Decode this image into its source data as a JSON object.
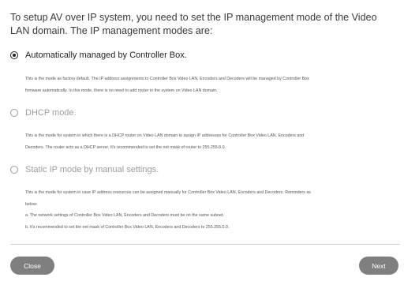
{
  "intro": "To setup AV over IP system, you need to set the IP management mode of the Video LAN domain. The IP management modes are:",
  "options": [
    {
      "label": "Automatically managed by Controller Box.",
      "selected": true,
      "description": [
        "This is the mode as factory default. The IP address assignments to Controller Box Video LAN, Encoders and Decoders will be managed by Controller Box",
        "firmware automatically. In this mode, there is no need to add router in the system on Video LAN domain."
      ]
    },
    {
      "label": "DHCP mode.",
      "selected": false,
      "description": [
        "This is the mode for system in which there is a DHCP router on Video LAN domain to assign IP addresses for Controller Box Video LAN, Encoders and",
        "Decoders. The router acts as a DHCP server. It's recommended to set the net mask of router to 255.255.0.0."
      ]
    },
    {
      "label": "Static IP mode by manual settings.",
      "selected": false,
      "description": [
        "This is the mode for system in case IP address resources can be assigned manually for Controller Box Video LAN, Encoders and Decoders. Reminders as",
        "below:",
        "a. The network settings of Controller Box Video LAN, Encoders and Decoders must be on the same subnet.",
        "b. It's recommended to set the net mask of Controller Box Video LAN, Encoders and Decoders to 255.255.0.0."
      ]
    }
  ],
  "buttons": {
    "close": "Close",
    "next": "Next"
  }
}
